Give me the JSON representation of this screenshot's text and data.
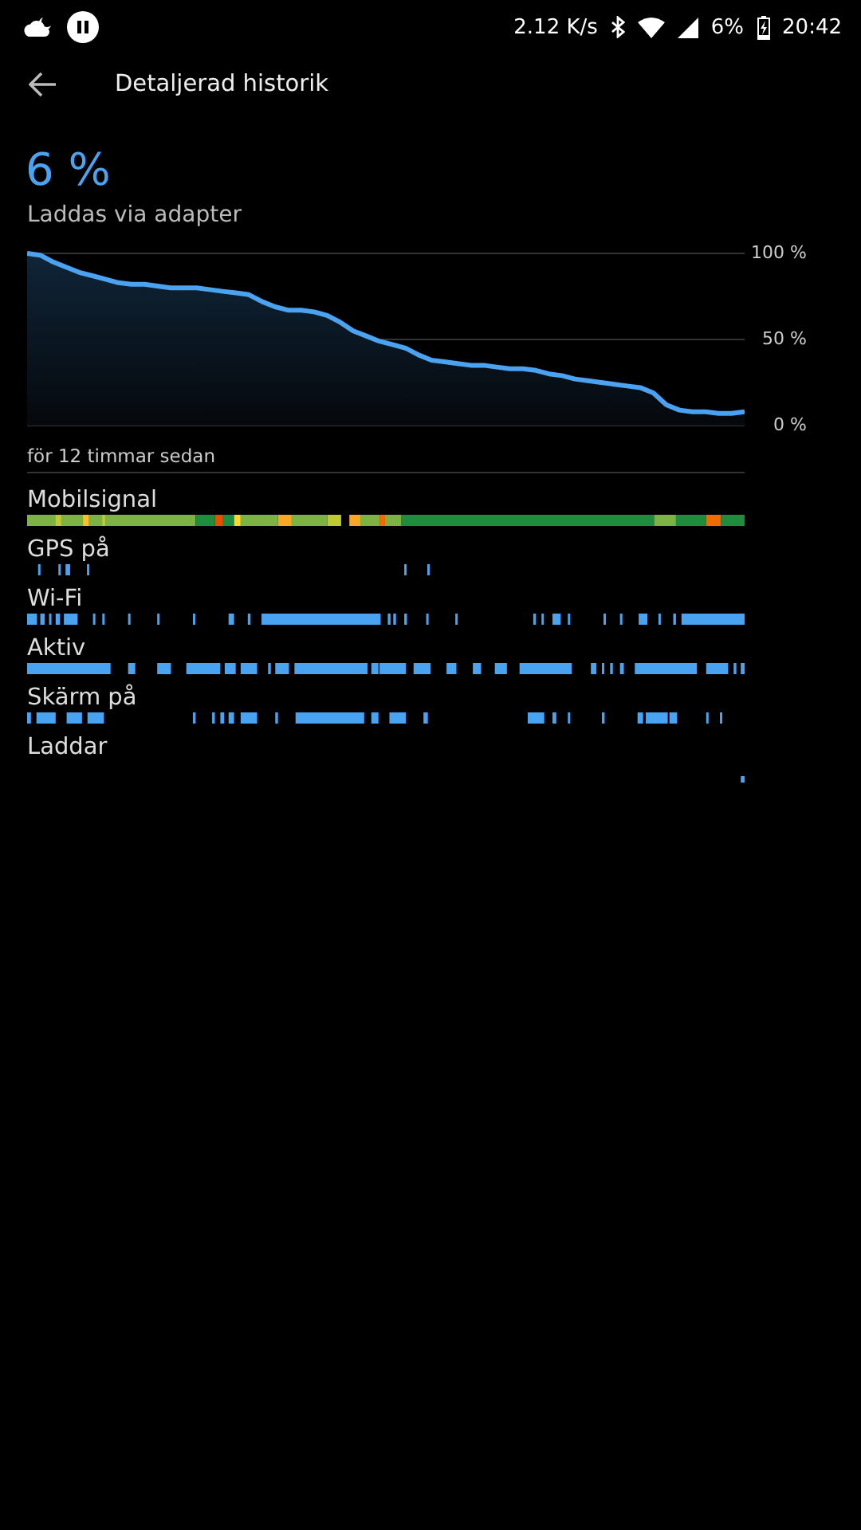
{
  "status_bar": {
    "speed": "2.12 K/s",
    "battery": "6%",
    "time": "20:42"
  },
  "header": {
    "title": "Detaljerad historik"
  },
  "summary": {
    "percent": "6 %",
    "status": "Laddas via adapter"
  },
  "battery_chart": {
    "chart_data": {
      "type": "area",
      "ylim": [
        0,
        100
      ],
      "yticks": [
        {
          "value": 100,
          "label": "100 %"
        },
        {
          "value": 50,
          "label": "50 %"
        },
        {
          "value": 0,
          "label": "0 %"
        }
      ],
      "series": [
        {
          "color": "#4aa3f0",
          "values": [
            100,
            99,
            95,
            92,
            89,
            87,
            85,
            83,
            82,
            82,
            81,
            80,
            80,
            80,
            79,
            78,
            77,
            76,
            72,
            69,
            67,
            67,
            66,
            64,
            60,
            55,
            52,
            49,
            47,
            45,
            41,
            38,
            37,
            36,
            35,
            35,
            34,
            33,
            33,
            32,
            30,
            29,
            27,
            26,
            25,
            24,
            23,
            22,
            19,
            12,
            9,
            8,
            8,
            7,
            7,
            8
          ]
        }
      ]
    },
    "start_label": "för 12 timmar sedan"
  },
  "timelines": [
    {
      "label": "Mobilsignal",
      "kind": "signal"
    },
    {
      "label": "GPS på",
      "kind": "gps"
    },
    {
      "label": "Wi-Fi",
      "kind": "wifi"
    },
    {
      "label": "Aktiv",
      "kind": "active"
    },
    {
      "label": "Skärm på",
      "kind": "screen"
    },
    {
      "label": "Laddar",
      "kind": "charging"
    }
  ]
}
